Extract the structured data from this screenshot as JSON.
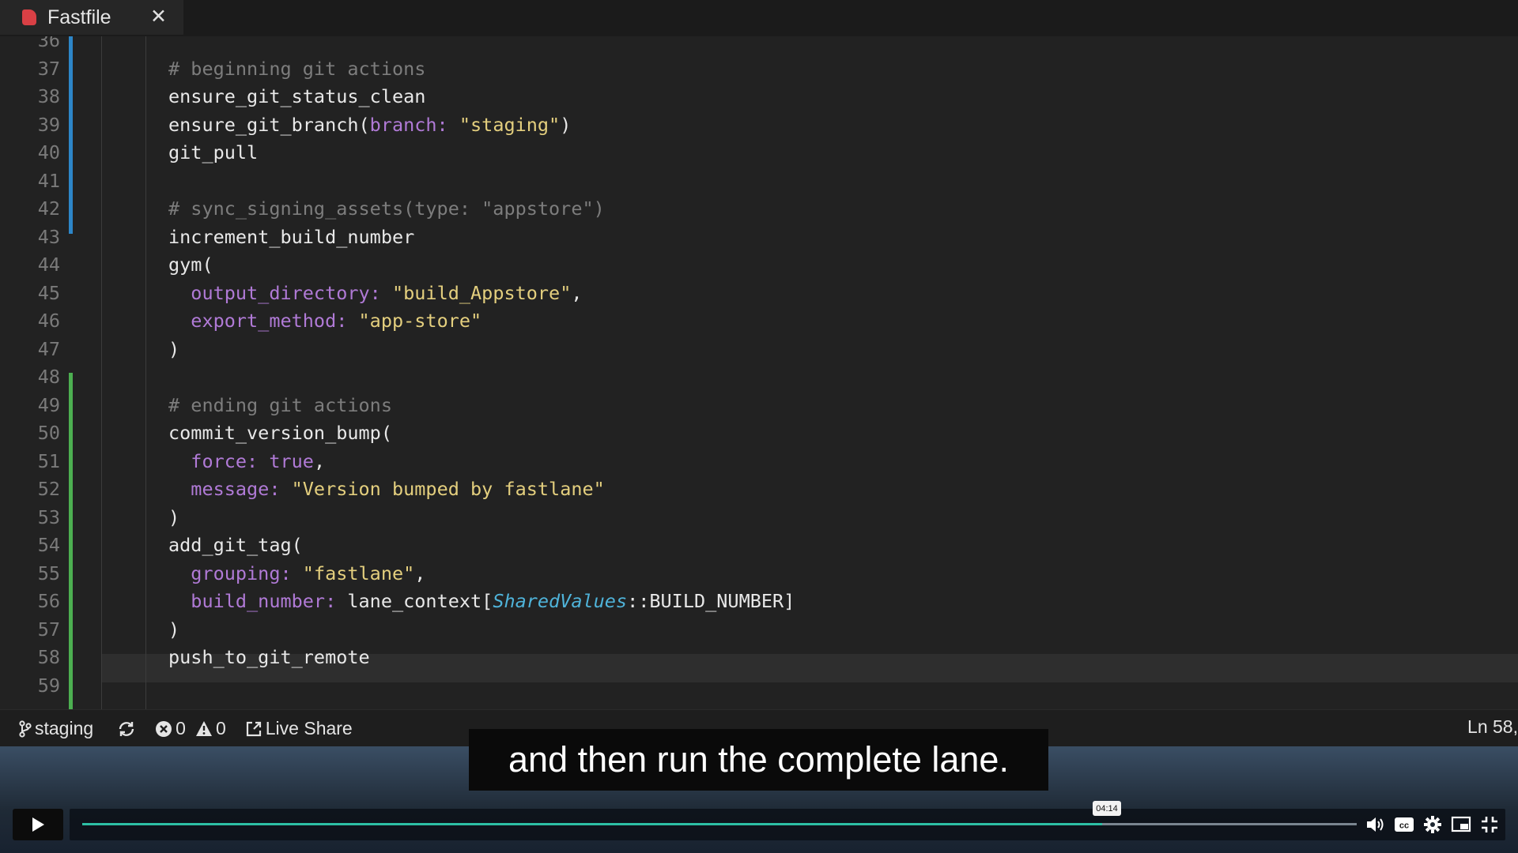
{
  "tab": {
    "title": "Fastfile",
    "close": "✕"
  },
  "editor": {
    "lines": [
      {
        "n": "36",
        "tokens": []
      },
      {
        "n": "37",
        "tokens": [
          {
            "t": "# beginning git actions",
            "c": "comment"
          }
        ]
      },
      {
        "n": "38",
        "tokens": [
          {
            "t": "ensure_git_status_clean",
            "c": ""
          }
        ]
      },
      {
        "n": "39",
        "tokens": [
          {
            "t": "ensure_git_branch(",
            "c": ""
          },
          {
            "t": "branch:",
            "c": "key"
          },
          {
            "t": " ",
            "c": ""
          },
          {
            "t": "\"staging\"",
            "c": "str"
          },
          {
            "t": ")",
            "c": ""
          }
        ]
      },
      {
        "n": "40",
        "tokens": [
          {
            "t": "git_pull",
            "c": ""
          }
        ]
      },
      {
        "n": "41",
        "tokens": []
      },
      {
        "n": "42",
        "tokens": [
          {
            "t": "# sync_signing_assets(type: \"appstore\")",
            "c": "comment"
          }
        ]
      },
      {
        "n": "43",
        "tokens": [
          {
            "t": "increment_build_number",
            "c": ""
          }
        ]
      },
      {
        "n": "44",
        "tokens": [
          {
            "t": "gym(",
            "c": ""
          }
        ]
      },
      {
        "n": "45",
        "tokens": [
          {
            "t": "  ",
            "c": ""
          },
          {
            "t": "output_directory:",
            "c": "key"
          },
          {
            "t": " ",
            "c": ""
          },
          {
            "t": "\"build_Appstore\"",
            "c": "str"
          },
          {
            "t": ",",
            "c": ""
          }
        ]
      },
      {
        "n": "46",
        "tokens": [
          {
            "t": "  ",
            "c": ""
          },
          {
            "t": "export_method:",
            "c": "key"
          },
          {
            "t": " ",
            "c": ""
          },
          {
            "t": "\"app-store\"",
            "c": "str"
          }
        ]
      },
      {
        "n": "47",
        "tokens": [
          {
            "t": ")",
            "c": ""
          }
        ]
      },
      {
        "n": "48",
        "tokens": []
      },
      {
        "n": "49",
        "tokens": [
          {
            "t": "# ending git actions",
            "c": "comment"
          }
        ]
      },
      {
        "n": "50",
        "tokens": [
          {
            "t": "commit_version_bump(",
            "c": ""
          }
        ]
      },
      {
        "n": "51",
        "tokens": [
          {
            "t": "  ",
            "c": ""
          },
          {
            "t": "force:",
            "c": "key"
          },
          {
            "t": " ",
            "c": ""
          },
          {
            "t": "true",
            "c": "key"
          },
          {
            "t": ",",
            "c": ""
          }
        ]
      },
      {
        "n": "52",
        "tokens": [
          {
            "t": "  ",
            "c": ""
          },
          {
            "t": "message:",
            "c": "key"
          },
          {
            "t": " ",
            "c": ""
          },
          {
            "t": "\"Version bumped by fastlane\"",
            "c": "str"
          }
        ]
      },
      {
        "n": "53",
        "tokens": [
          {
            "t": ")",
            "c": ""
          }
        ]
      },
      {
        "n": "54",
        "tokens": [
          {
            "t": "add_git_tag(",
            "c": ""
          }
        ]
      },
      {
        "n": "55",
        "tokens": [
          {
            "t": "  ",
            "c": ""
          },
          {
            "t": "grouping:",
            "c": "key"
          },
          {
            "t": " ",
            "c": ""
          },
          {
            "t": "\"fastlane\"",
            "c": "str"
          },
          {
            "t": ",",
            "c": ""
          }
        ]
      },
      {
        "n": "56",
        "tokens": [
          {
            "t": "  ",
            "c": ""
          },
          {
            "t": "build_number:",
            "c": "key"
          },
          {
            "t": " lane_context[",
            "c": ""
          },
          {
            "t": "SharedValues",
            "c": "cls"
          },
          {
            "t": "::BUILD_NUMBER]",
            "c": ""
          }
        ]
      },
      {
        "n": "57",
        "tokens": [
          {
            "t": ")",
            "c": ""
          }
        ]
      },
      {
        "n": "58",
        "tokens": [
          {
            "t": "push_to_git_remote",
            "c": ""
          }
        ]
      },
      {
        "n": "59",
        "tokens": []
      }
    ]
  },
  "statusbar": {
    "branch": "staging",
    "errors": "0",
    "warnings": "0",
    "live_share": "Live Share",
    "position": "Ln 58,"
  },
  "video": {
    "caption": "and then run the complete lane.",
    "time_badge": "04:14",
    "progress": 0.8,
    "accent": "#2dbfa5"
  }
}
